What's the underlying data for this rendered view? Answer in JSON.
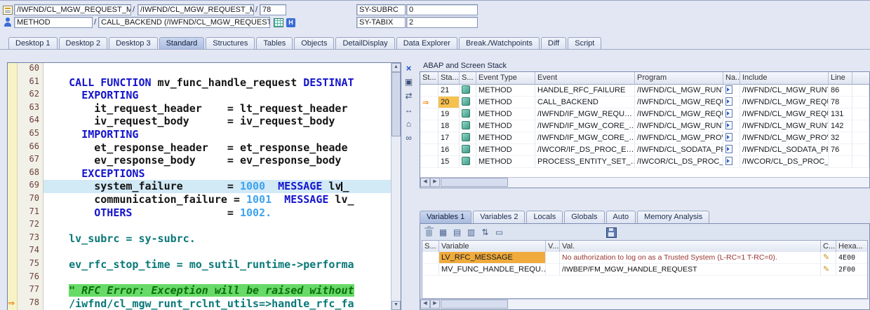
{
  "icons": {
    "exec_arrow": "⇒",
    "up": "▲",
    "down": "▼",
    "left": "◀",
    "right": "▶",
    "pencil": "✎"
  },
  "header": {
    "sep": "/",
    "row1": {
      "program": "/IWFND/CL_MGW_REQUEST_MANAGER…",
      "include": "/IWFND/CL_MGW_REQUEST_MANAGER…",
      "line": "78",
      "sy_subrc_label": "SY-SUBRC",
      "sy_subrc_value": "0"
    },
    "row2": {
      "event_type": "METHOD",
      "event": "CALL_BACKEND (/IWFND/CL_MGW_REQUEST_MANAGE…",
      "nav_icon_letter": "H",
      "sy_tabix_label": "SY-TABIX",
      "sy_tabix_value": "2"
    }
  },
  "tabs": {
    "labels": [
      "Desktop 1",
      "Desktop 2",
      "Desktop 3",
      "Standard",
      "Structures",
      "Tables",
      "Objects",
      "DetailDisplay",
      "Data Explorer",
      "Break./Watchpoints",
      "Diff",
      "Script"
    ],
    "active": "Standard"
  },
  "editor_tools": [
    {
      "name": "close-icon",
      "glyph": "×",
      "accent": true
    },
    {
      "name": "services-icon",
      "glyph": "▣"
    },
    {
      "name": "swap-layout-icon",
      "glyph": "⇄"
    },
    {
      "name": "horizontal-resize-icon",
      "glyph": "↔"
    },
    {
      "name": "goto-statement-icon",
      "glyph": "⌂"
    },
    {
      "name": "watchpoint-icon",
      "glyph": "∞"
    }
  ],
  "editor": {
    "lines": [
      {
        "no": "60",
        "segs": []
      },
      {
        "no": "61",
        "segs": [
          [
            "    ",
            "p"
          ],
          [
            "CALL FUNCTION",
            "k"
          ],
          [
            " mv_func_handle_request ",
            "p"
          ],
          [
            "DESTINAT",
            "k"
          ]
        ]
      },
      {
        "no": "62",
        "segs": [
          [
            "      ",
            "p"
          ],
          [
            "EXPORTING",
            "k"
          ]
        ]
      },
      {
        "no": "63",
        "segs": [
          [
            "        it_request_header    = lt_request_header",
            "p"
          ]
        ]
      },
      {
        "no": "64",
        "segs": [
          [
            "        iv_request_body      = iv_request_body",
            "p"
          ]
        ]
      },
      {
        "no": "65",
        "segs": [
          [
            "      ",
            "p"
          ],
          [
            "IMPORTING",
            "k"
          ]
        ]
      },
      {
        "no": "66",
        "segs": [
          [
            "        et_response_header   = et_response_heade",
            "p"
          ]
        ]
      },
      {
        "no": "67",
        "segs": [
          [
            "        ev_response_body     = ev_response_body",
            "p"
          ]
        ]
      },
      {
        "no": "68",
        "segs": [
          [
            "      ",
            "p"
          ],
          [
            "EXCEPTIONS",
            "k"
          ]
        ]
      },
      {
        "no": "69",
        "hl": true,
        "segs": [
          [
            "        system_failure       = ",
            "p"
          ],
          [
            "1000",
            "n"
          ],
          [
            "  ",
            "p"
          ],
          [
            "MESSAGE",
            "k"
          ],
          [
            " lv",
            "p"
          ],
          [
            "",
            "caret"
          ],
          [
            "_",
            "p"
          ]
        ]
      },
      {
        "no": "70",
        "segs": [
          [
            "        communication_failure = ",
            "p"
          ],
          [
            "1001",
            "n"
          ],
          [
            "  ",
            "p"
          ],
          [
            "MESSAGE",
            "k"
          ],
          [
            " lv_",
            "p"
          ]
        ]
      },
      {
        "no": "71",
        "segs": [
          [
            "        ",
            "p"
          ],
          [
            "OTHERS",
            "k"
          ],
          [
            "               = ",
            "p"
          ],
          [
            "1002.",
            "n"
          ]
        ]
      },
      {
        "no": "72",
        "segs": []
      },
      {
        "no": "73",
        "segs": [
          [
            "    lv_subrc = sy-subrc.",
            "t"
          ]
        ]
      },
      {
        "no": "74",
        "segs": []
      },
      {
        "no": "75",
        "segs": [
          [
            "    ev_rfc_stop_time = mo_sutil_runtime->performa",
            "t"
          ]
        ]
      },
      {
        "no": "76",
        "segs": []
      },
      {
        "no": "77",
        "segs": [
          [
            "    ",
            "p"
          ],
          [
            "\" RFC Error: Exception will be raised without",
            "ch"
          ]
        ]
      },
      {
        "no": "78",
        "arrow": true,
        "segs": [
          [
            "    /iwfnd/cl_mgw_runt_rclnt_utils=>handle_rfc_fa",
            "t"
          ]
        ]
      }
    ]
  },
  "stack": {
    "title": "ABAP and Screen Stack",
    "columns": [
      "St...",
      "Sta...",
      "S...",
      "Event Type",
      "Event",
      "Program",
      "Na...",
      "Include",
      "Line"
    ],
    "rows": [
      {
        "current": false,
        "no": "21",
        "type": "METHOD",
        "event": "HANDLE_RFC_FAILURE",
        "program": "/IWFND/CL_MGW_RUNT…",
        "include": "/IWFND/CL_MGW_RUNT…",
        "line": "86"
      },
      {
        "current": true,
        "no": "20",
        "type": "METHOD",
        "event": "CALL_BACKEND",
        "program": "/IWFND/CL_MGW_REQU…",
        "include": "/IWFND/CL_MGW_REQU…",
        "line": "78"
      },
      {
        "current": false,
        "no": "19",
        "type": "METHOD",
        "event": "/IWFND/IF_MGW_REQU…",
        "program": "/IWFND/CL_MGW_REQU…",
        "include": "/IWFND/CL_MGW_REQU…",
        "line": "131"
      },
      {
        "current": false,
        "no": "18",
        "type": "METHOD",
        "event": "/IWFND/IF_MGW_CORE_…",
        "program": "/IWFND/CL_MGW_RUNT…",
        "include": "/IWFND/CL_MGW_RUNT…",
        "line": "142"
      },
      {
        "current": false,
        "no": "17",
        "type": "METHOD",
        "event": "/IWFND/IF_MGW_CORE_…",
        "program": "/IWFND/CL_MGW_PROV…",
        "include": "/IWFND/CL_MGW_PROV…",
        "line": "32"
      },
      {
        "current": false,
        "no": "16",
        "type": "METHOD",
        "event": "/IWCOR/IF_DS_PROC_E…",
        "program": "/IWFND/CL_SODATA_PR…",
        "include": "/IWFND/CL_SODATA_PR…",
        "line": "76"
      },
      {
        "current": false,
        "no": "15",
        "type": "METHOD",
        "event": "PROCESS_ENTITY_SET_…",
        "program": "/IWCOR/CL_DS_PROC_D…",
        "include": "/IWCOR/CL_DS_PROC_D…",
        "line": ""
      }
    ]
  },
  "variables": {
    "tabs": [
      "Variables 1",
      "Variables 2",
      "Locals",
      "Globals",
      "Auto",
      "Memory Analysis"
    ],
    "active_tab": "Variables 1",
    "columns": [
      "S...",
      "Variable",
      "V...",
      "Val.",
      "C...",
      "Hexa..."
    ],
    "toolbar_icons": [
      {
        "name": "delete-variables-icon",
        "glyph": "trash"
      },
      {
        "name": "table-layout-icon",
        "glyph": "▦"
      },
      {
        "name": "change-layout-icon",
        "glyph": "▤"
      },
      {
        "name": "select-columns-icon",
        "glyph": "▥"
      },
      {
        "name": "sort-icon",
        "glyph": "⇅"
      },
      {
        "name": "services-icon",
        "glyph": "▭"
      }
    ],
    "rows": [
      {
        "variable": "LV_RFC_MESSAGE",
        "value": "No authorization to log on as a Trusted System (L-RC=1 T-RC=0).",
        "hex": "4E00",
        "highlight": true,
        "emphasis": "error"
      },
      {
        "variable": "MV_FUNC_HANDLE_REQU…",
        "value": "/IWBEP/FM_MGW_HANDLE_REQUEST",
        "hex": "2F00",
        "highlight": false,
        "emphasis": "normal"
      }
    ]
  }
}
